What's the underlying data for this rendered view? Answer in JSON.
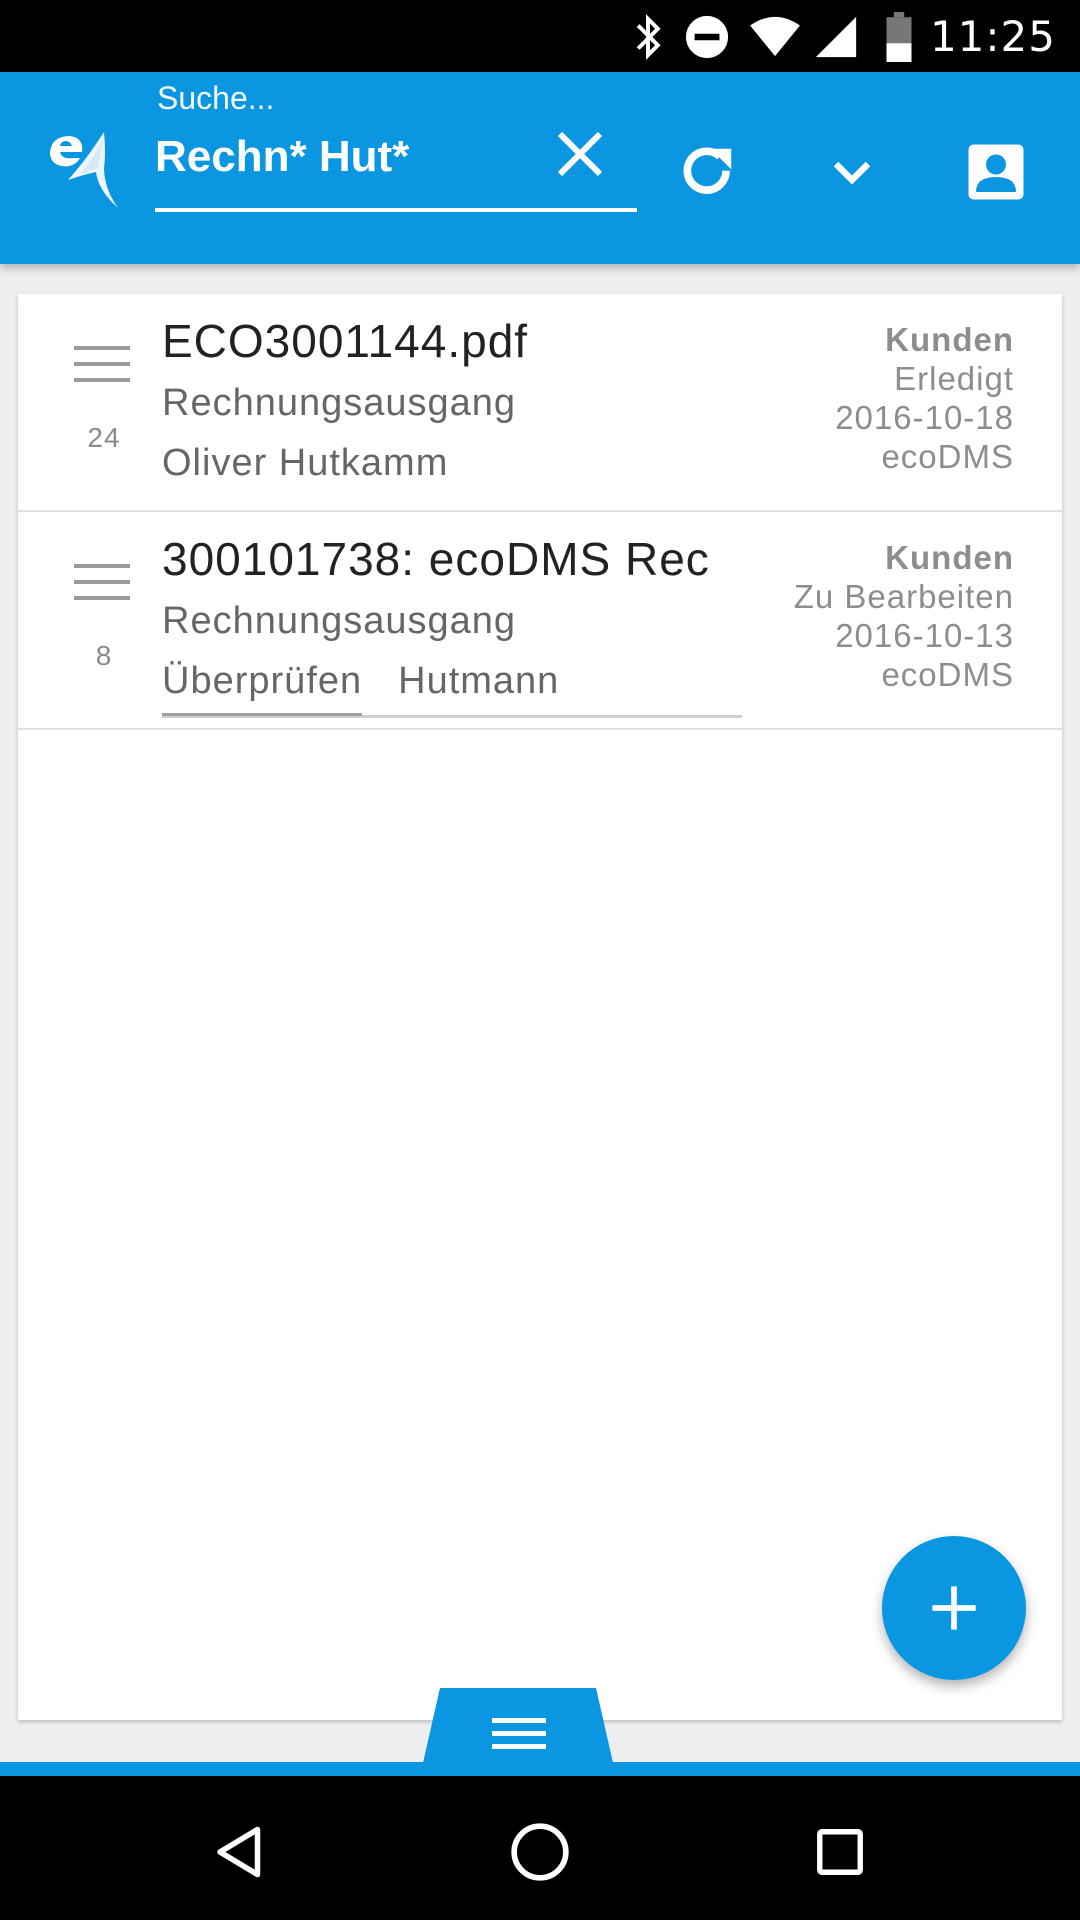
{
  "status_bar": {
    "time": "11:25",
    "icons": [
      "bluetooth-icon",
      "do-not-disturb-icon",
      "wifi-icon",
      "cell-signal-icon",
      "battery-icon"
    ]
  },
  "app_bar": {
    "logo": "ecodms-logo-icon",
    "search": {
      "placeholder": "Suche...",
      "value": "Rechn* Hut*"
    },
    "actions": [
      "clear-icon",
      "refresh-icon",
      "chevron-down-icon",
      "account-icon"
    ]
  },
  "documents": [
    {
      "count": "24",
      "title": "ECO3001144.pdf",
      "type": "Rechnungsausgang",
      "line3": "Oliver Hutkamm",
      "category": "Kunden",
      "status": "Erledigt",
      "date": "2016-10-18",
      "owner": "ecoDMS"
    },
    {
      "count": "8",
      "title": "300101738: ecoDMS Rec",
      "type": "Rechnungsausgang",
      "tags": [
        "Überprüfen",
        "Hutmann"
      ],
      "category": "Kunden",
      "status": "Zu Bearbeiten",
      "date": "2016-10-13",
      "owner": "ecoDMS"
    }
  ],
  "colors": {
    "primary": "#0a96e0",
    "text_primary": "#222222",
    "text_secondary": "#666666",
    "text_meta": "#8d8d8d"
  }
}
